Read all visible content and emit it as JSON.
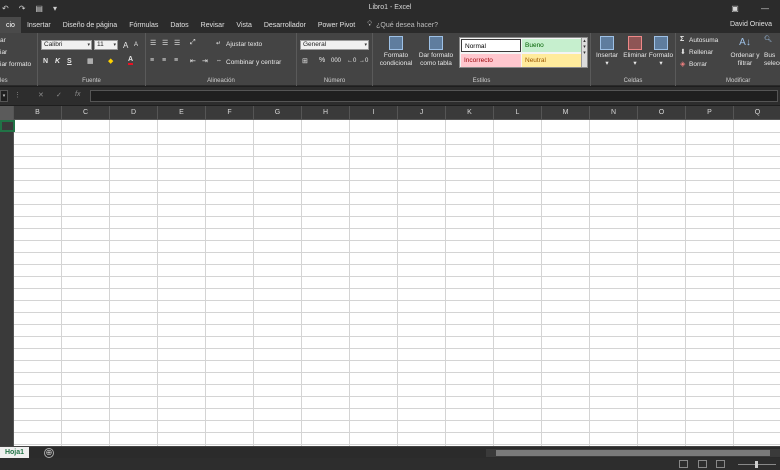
{
  "title": "Libro1 - Excel",
  "quick_access": [
    "↶",
    "↷",
    "▤",
    "▾"
  ],
  "window_controls": [
    "▣",
    "—"
  ],
  "tabs": [
    "cio",
    "Insertar",
    "Diseño de página",
    "Fórmulas",
    "Datos",
    "Revisar",
    "Vista",
    "Desarrollador",
    "Power Pivot"
  ],
  "tell_me": "¿Qué desea hacer?",
  "user": "David Onieva",
  "ribbon": {
    "clipboard": {
      "items": [
        "ar",
        "iar",
        "iar formato"
      ],
      "label": "les"
    },
    "font": {
      "font_name": "Calibri",
      "font_size": "11",
      "bold": "N",
      "italic": "K",
      "underline": "S",
      "grow": "A",
      "shrink": "A",
      "font_color": "A",
      "label": "Fuente"
    },
    "alignment": {
      "wrap": "Ajustar texto",
      "merge": "Combinar y centrar",
      "label": "Alineación"
    },
    "number": {
      "format": "General",
      "percent": "%",
      "thousands": "000",
      "label": "Número"
    },
    "styles": {
      "cond_format": [
        "Formato",
        "condicional"
      ],
      "table_format": [
        "Dar formato",
        "como tabla"
      ],
      "normal": "Normal",
      "good": "Bueno",
      "bad": "Incorrecto",
      "neutral": "Neutral",
      "label": "Estilos"
    },
    "cells": {
      "insert": "Insertar",
      "delete": "Eliminar",
      "format": "Formato",
      "label": "Celdas"
    },
    "edit": {
      "autosum": "Autosuma",
      "fill": "Rellenar",
      "clear": "Borrar",
      "sort": [
        "Ordenar y",
        "filtrar"
      ],
      "find": [
        "Bus",
        "selecc"
      ],
      "label": "Modificar"
    }
  },
  "formula_bar": {
    "name_box": "",
    "fx": "fx",
    "cancel": "✕",
    "enter": "✓"
  },
  "columns": [
    "A",
    "B",
    "C",
    "D",
    "E",
    "F",
    "G",
    "H",
    "I",
    "J",
    "K",
    "L",
    "M",
    "N",
    "O",
    "P",
    "Q"
  ],
  "sheets": [
    "Hoja1"
  ],
  "add_sheet": "⊕",
  "colors": {
    "accent": "#217346",
    "ribbon_bg": "#444444",
    "title_bg": "#2b2b2b",
    "grid_line": "#d4d4d4",
    "style_good_bg": "#c6efce",
    "style_bad_bg": "#ffc7ce",
    "style_neutral_bg": "#ffeb9c"
  }
}
